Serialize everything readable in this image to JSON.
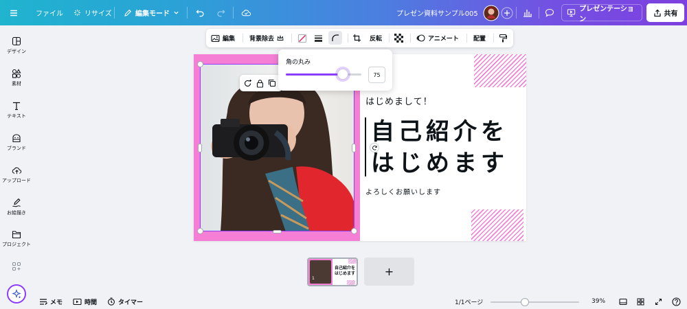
{
  "topbar": {
    "file_label": "ファイル",
    "resize_label": "リサイズ",
    "edit_mode_label": "編集モード",
    "doc_title": "プレゼン資料サンプル005",
    "present_label": "プレゼンテーション",
    "share_label": "共有"
  },
  "sidebar": {
    "items": [
      {
        "label": "デザイン",
        "icon": "design-icon"
      },
      {
        "label": "素材",
        "icon": "elements-icon"
      },
      {
        "label": "テキスト",
        "icon": "text-icon"
      },
      {
        "label": "ブランド",
        "icon": "brand-icon"
      },
      {
        "label": "アップロード",
        "icon": "upload-icon"
      },
      {
        "label": "お絵描き",
        "icon": "draw-icon"
      },
      {
        "label": "プロジェクト",
        "icon": "project-icon"
      }
    ]
  },
  "context_toolbar": {
    "edit_label": "編集",
    "bg_remove_label": "背景除去",
    "flip_label": "反転",
    "animate_label": "アニメート",
    "position_label": "配置"
  },
  "corner_popover": {
    "label": "角の丸み",
    "value": "75",
    "level": 0.75
  },
  "design": {
    "greeting": "はじめまして！",
    "title_line1": "自己紹介を",
    "title_line2": "はじめます",
    "subtitle": "よろしくお願いします",
    "thumb_title1": "自己紹介を",
    "thumb_title2": "はじめます",
    "thumb_page_number": "1"
  },
  "thumbnails": {
    "add_page_label": "+"
  },
  "bottombar": {
    "notes_label": "メモ",
    "time_label": "時間",
    "timer_label": "タイマー",
    "page_count": "1/1ページ",
    "zoom_label": "39%",
    "zoom_level": 0.39
  },
  "colors": {
    "accent_purple": "#8b3dff",
    "frame_pink": "#f47fd4"
  }
}
